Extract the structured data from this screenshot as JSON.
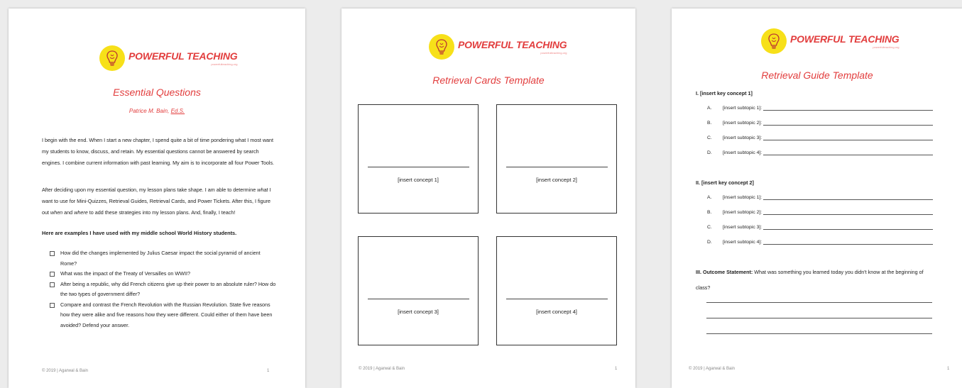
{
  "brand": {
    "title": "POWERFUL TEACHING",
    "url": "powerfulteaching.org",
    "colors": {
      "accent": "#e23d3d",
      "logo_yellow": "#f7e019"
    },
    "logo_icon": "brain-lightbulb-icon"
  },
  "page1": {
    "title": "Essential Questions",
    "author_name": "Patrice M. Bain,",
    "author_degree": "Ed.S.",
    "paragraph1": "I begin with the end.  When I start a new chapter, I spend quite a bit of time pondering what I most want my students to know, discuss, and retain. My essential questions cannot be answered by search engines. I combine current information with past learning. My aim is to incorporate all four Power Tools.",
    "paragraph2": {
      "s1": "After deciding upon my essential question, my lesson plans take shape. I am able to determine ",
      "what": "what",
      "s2": " I want to use for Mini-Quizzes, Retrieval Guides, Retrieval Cards, and Power Tickets. After this, I figure out ",
      "when": "when",
      "s3": " and ",
      "where": "where",
      "s4": " to add these strategies into my lesson plans. And, finally, I teach!"
    },
    "examples_heading": "Here are examples I have used with my middle school World History students.",
    "questions": [
      "How did the changes implemented by Julius Caesar impact the social pyramid of ancient Rome?",
      "What was the impact of the Treaty of Versailles on WWII?",
      "After being a republic, why did French citizens give up their power to an absolute ruler? How do the two types of government differ?",
      "Compare and contrast the French Revolution with the Russian Revolution. State five reasons how they were alike and five reasons how they were different. Could either of them have been avoided? Defend your answer."
    ],
    "footer_left": "© 2019 | Agarwal & Bain",
    "footer_right": "1"
  },
  "page2": {
    "title": "Retrieval Cards Template",
    "cards": [
      "[insert concept 1]",
      "[insert concept 2]",
      "[insert concept 3]",
      "[insert concept 4]"
    ],
    "footer_left": "© 2019 | Agarwal & Bain",
    "footer_right": "1"
  },
  "page3": {
    "title": "Retrieval Guide Template",
    "section1": {
      "heading": "I.   [insert key concept 1]",
      "items": [
        {
          "letter": "A.",
          "text": "[insert subtopic 1]:"
        },
        {
          "letter": "B.",
          "text": "[insert subtopic 2]:"
        },
        {
          "letter": "C.",
          "text": "[insert subtopic 3]:"
        },
        {
          "letter": "D.",
          "text": "[insert subtopic 4]:"
        }
      ]
    },
    "section2": {
      "heading": "II.  [insert key concept 2]",
      "items": [
        {
          "letter": "A.",
          "text": "[insert subtopic 1]:"
        },
        {
          "letter": "B.",
          "text": "[insert subtopic 2]:"
        },
        {
          "letter": "C.",
          "text": "[insert subtopic 3]:"
        },
        {
          "letter": "D.",
          "text": "[insert subtopic 4]:"
        }
      ]
    },
    "outcome_label": "III. Outcome Statement:",
    "outcome_text": " What was something you learned today you didn't know at the beginning of class?",
    "footer_left": "© 2019 | Agarwal & Bain",
    "footer_right": "1"
  }
}
